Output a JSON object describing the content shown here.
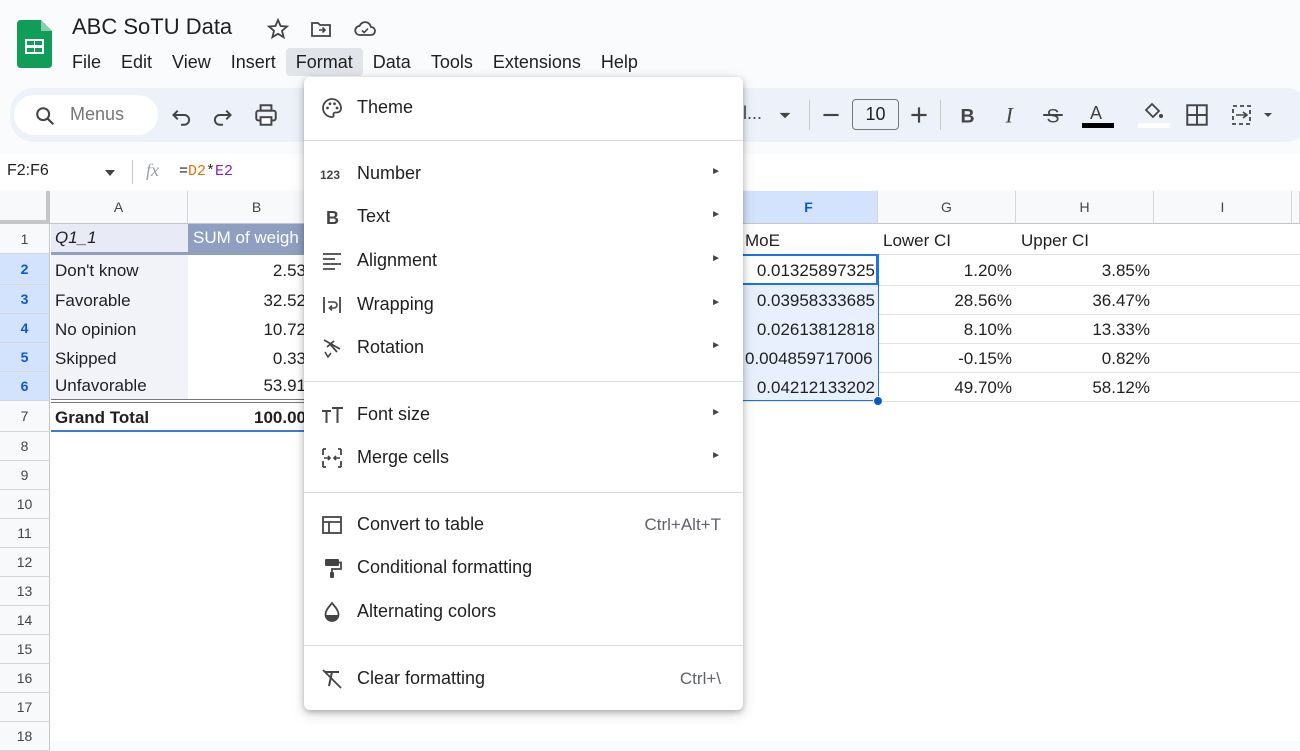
{
  "app": {
    "title": "ABC SoTU Data",
    "menus": [
      "File",
      "Edit",
      "View",
      "Insert",
      "Format",
      "Data",
      "Tools",
      "Extensions",
      "Help"
    ],
    "active_menu": "Format"
  },
  "toolbar": {
    "search_placeholder": "Menus",
    "font_truncated": "l...",
    "font_size": "10"
  },
  "formula_bar": {
    "range": "F2:F6",
    "formula_eq": "=",
    "formula_ref1": "D2",
    "formula_op": "*",
    "formula_ref2": "E2"
  },
  "columns": [
    "A",
    "B",
    "F",
    "G",
    "H",
    "I"
  ],
  "rows": [
    "1",
    "2",
    "3",
    "4",
    "5",
    "6",
    "7",
    "8",
    "9",
    "10",
    "11",
    "12",
    "13",
    "14",
    "15",
    "16",
    "17",
    "18"
  ],
  "cells": {
    "a1": "Q1_1",
    "b1": "SUM of weigh",
    "f1": "MoE",
    "g1": "Lower CI",
    "h1": "Upper CI",
    "a2": "Don't know",
    "b2": "2.53",
    "f2": "0.01325897325",
    "g2": "1.20%",
    "h2": "3.85%",
    "a3": "Favorable",
    "b3": "32.52",
    "f3": "0.03958333685",
    "g3": "28.56%",
    "h3": "36.47%",
    "a4": "No opinion",
    "b4": "10.72",
    "f4": "0.02613812818",
    "g4": "8.10%",
    "h4": "13.33%",
    "a5": "Skipped",
    "b5": "0.33",
    "f5": "0.004859717006",
    "g5": "-0.15%",
    "h5": "0.82%",
    "a6": "Unfavorable",
    "b6": "53.91",
    "f6": "0.04212133202",
    "g6": "49.70%",
    "h6": "58.12%",
    "a7": "Grand Total",
    "b7": "100.00"
  },
  "format_menu": {
    "theme": "Theme",
    "number": "Number",
    "text": "Text",
    "alignment": "Alignment",
    "wrapping": "Wrapping",
    "rotation": "Rotation",
    "font_size": "Font size",
    "merge_cells": "Merge cells",
    "convert_to_table": "Convert to table",
    "convert_shortcut": "Ctrl+Alt+T",
    "conditional_formatting": "Conditional formatting",
    "alternating_colors": "Alternating colors",
    "clear_formatting": "Clear formatting",
    "clear_shortcut": "Ctrl+\\",
    "submenu_arrow": "►"
  },
  "colors": {
    "accent": "#0b57d0",
    "selection_fill": "#e8f0fe",
    "pivot_header": "#8e9fc2",
    "pivot_rowlabel": "#e8eaf6"
  }
}
